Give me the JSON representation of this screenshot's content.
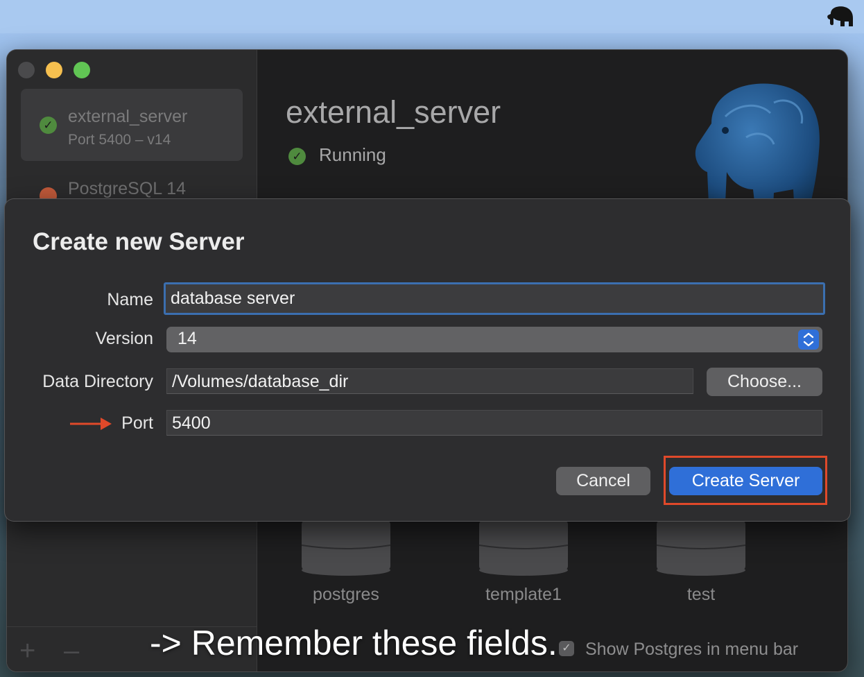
{
  "menubar": {
    "icon": "elephant-icon"
  },
  "sidebar": {
    "servers": [
      {
        "name": "external_server",
        "subtitle": "Port 5400 – v14",
        "status": "running"
      },
      {
        "name": "PostgreSQL 14",
        "status": "stopped"
      }
    ],
    "add_label": "+",
    "remove_label": "–"
  },
  "main": {
    "server_title": "external_server",
    "status_text": "Running",
    "databases": [
      "postgres",
      "template1",
      "test"
    ],
    "show_in_menubar_label": "Show Postgres in menu bar",
    "show_in_menubar_checked": true
  },
  "dialog": {
    "title": "Create new Server",
    "fields": {
      "name_label": "Name",
      "name_value": "database server",
      "version_label": "Version",
      "version_value": "14",
      "data_dir_label": "Data Directory",
      "data_dir_value": "/Volumes/database_dir",
      "port_label": "Port",
      "port_value": "5400"
    },
    "choose_label": "Choose...",
    "cancel_label": "Cancel",
    "create_label": "Create Server"
  },
  "annotation": {
    "text": "-> Remember these fields."
  },
  "colors": {
    "accent_blue": "#2f6fd8",
    "highlight_red": "#e0492a",
    "running_green": "#4f8a3e"
  }
}
